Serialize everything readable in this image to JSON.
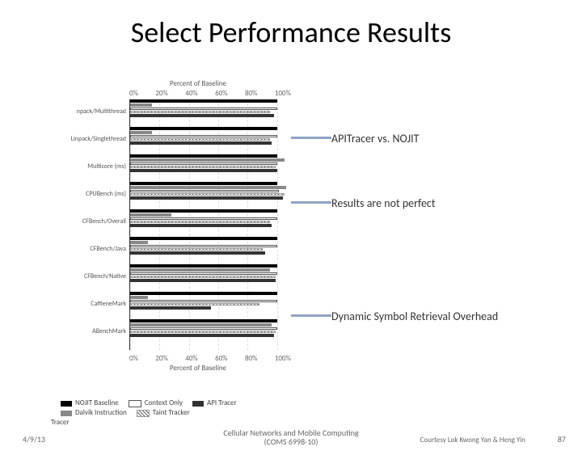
{
  "title": "Select Performance Results",
  "callouts": {
    "c1": "APITracer vs. NOJIT",
    "c2": "Results are not perfect",
    "c3": "Dynamic Symbol Retrieval Overhead"
  },
  "footer": {
    "date": "4/9/13",
    "center_line1": "Cellular Networks and Mobile Computing",
    "center_line2": "(COMS 6998-10)",
    "courtesy": "Courtesy Lok Kwong Yan & Heng Yin",
    "page": "87"
  },
  "chart_data": {
    "type": "bar",
    "orientation": "horizontal",
    "xlabel": "Percent of Baseline",
    "xlim": [
      0,
      110
    ],
    "ticks": [
      "0%",
      "20%",
      "40%",
      "60%",
      "80%",
      "100%"
    ],
    "categories": [
      "npack/Multithread",
      "Linpack/Singlethread",
      "Multicore (ms)",
      "CPUBench (ms)",
      "CFBench/Overall",
      "CFBench/Java",
      "CFBench/Native",
      "CaffieneMark",
      "ABenchMark"
    ],
    "series": [
      {
        "name": "NOJIT Baseline",
        "key": "nojit",
        "values": [
          100,
          100,
          100,
          100,
          100,
          100,
          100,
          100,
          100
        ]
      },
      {
        "name": "Dalvik Instruction",
        "key": "dalvik",
        "values": [
          15,
          15,
          105,
          106,
          28,
          12,
          95,
          12,
          96
        ]
      },
      {
        "name": "Context Only",
        "key": "context",
        "values": [
          100,
          100,
          100,
          101,
          100,
          100,
          100,
          100,
          100
        ]
      },
      {
        "name": "Taint Tracker",
        "key": "taint",
        "values": [
          95,
          95,
          99,
          105,
          95,
          90,
          99,
          88,
          99
        ]
      },
      {
        "name": "API Tracer",
        "key": "api",
        "values": [
          98,
          96,
          100,
          104,
          96,
          92,
          99,
          55,
          98
        ]
      }
    ],
    "legend_position": "bottom"
  }
}
